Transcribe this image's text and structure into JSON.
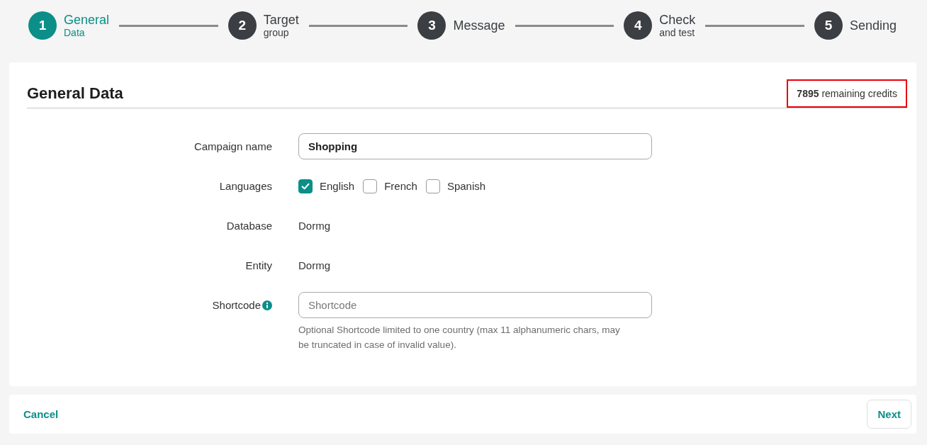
{
  "stepper": {
    "steps": [
      {
        "number": "1",
        "title": "General",
        "subtitle": "Data",
        "selected": true
      },
      {
        "number": "2",
        "title": "Target",
        "subtitle": "group",
        "selected": false
      },
      {
        "number": "3",
        "title": "Message",
        "selected": false
      },
      {
        "number": "4",
        "title": "Check",
        "subtitle": "and test",
        "selected": false
      },
      {
        "number": "5",
        "title": "Sending",
        "selected": false
      }
    ]
  },
  "card": {
    "title": "General Data",
    "credits": {
      "text": "**7895** remaining credits",
      "highlighted": true
    }
  },
  "form": {
    "fields": [
      {
        "kind": "text",
        "label": "Campaign name",
        "value": "Shopping"
      },
      {
        "kind": "checkboxes",
        "label": "Languages",
        "options": [
          {
            "label": "English",
            "checked": true
          },
          {
            "label": "French",
            "checked": false
          },
          {
            "label": "Spanish",
            "checked": false
          }
        ]
      },
      {
        "kind": "static",
        "label": "Database",
        "value": "Dormg"
      },
      {
        "kind": "static",
        "label": "Entity",
        "value": "Dormg"
      },
      {
        "kind": "text",
        "label": "Shortcode",
        "info": true,
        "placeholder": "Shortcode",
        "help": "Optional Shortcode limited to one country (max 11 alphanumeric chars, may be truncated in case of invalid value)."
      }
    ]
  },
  "footer": {
    "cancel": "Cancel",
    "next": "Next"
  }
}
